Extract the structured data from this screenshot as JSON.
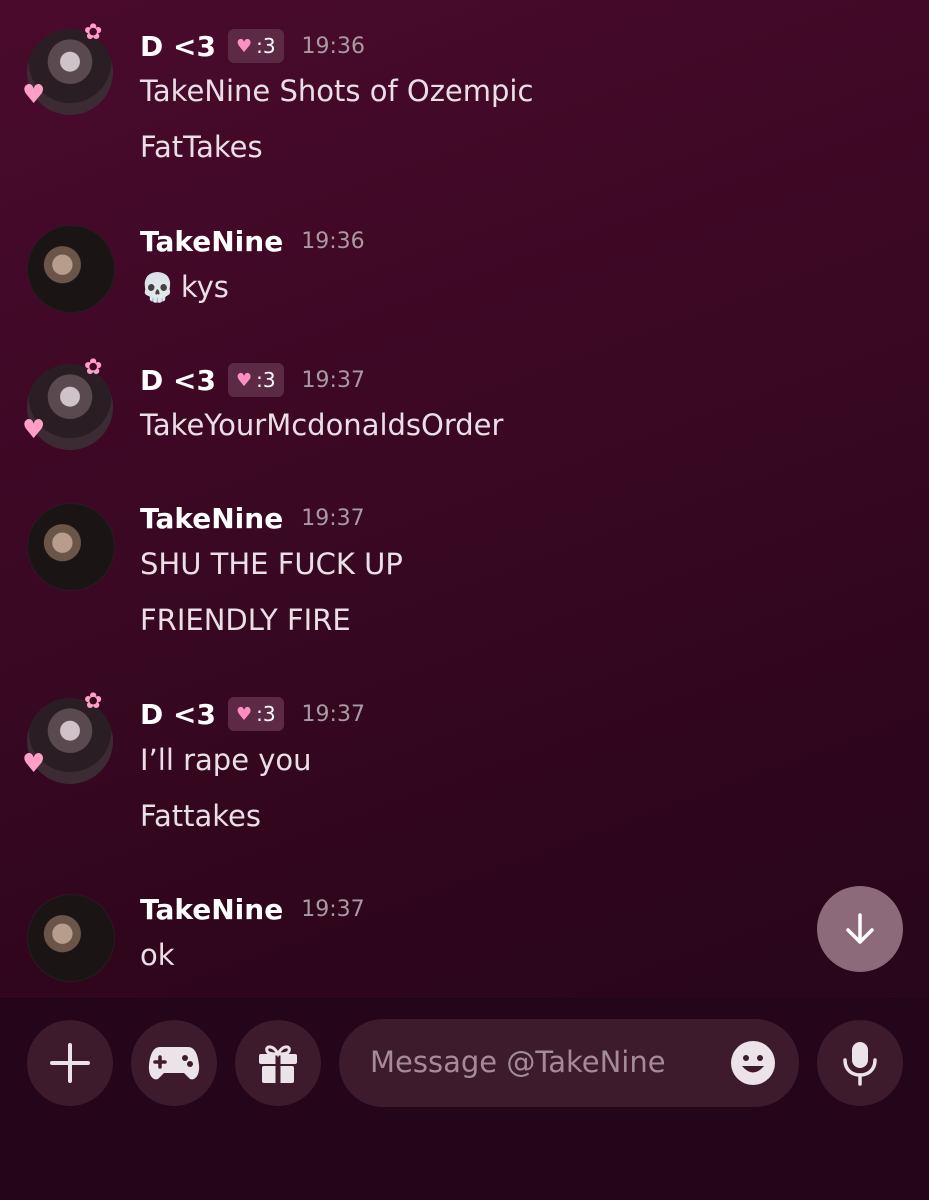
{
  "messages": [
    {
      "author": "D <3",
      "badge": ":3",
      "time": "19:36",
      "lines": [
        "TakeNine Shots of Ozempic",
        "FatTakes"
      ]
    },
    {
      "author": "TakeNine",
      "time": "19:36",
      "lines": [
        "kys"
      ],
      "emoji": "💀"
    },
    {
      "author": "D <3",
      "badge": ":3",
      "time": "19:37",
      "lines": [
        "TakeYourMcdonaldsOrder"
      ]
    },
    {
      "author": "TakeNine",
      "time": "19:37",
      "lines": [
        "SHU THE FUCK UP",
        "FRIENDLY FIRE"
      ]
    },
    {
      "author": "D <3",
      "badge": ":3",
      "time": "19:37",
      "lines": [
        "I’ll rape you",
        "Fattakes"
      ]
    },
    {
      "author": "TakeNine",
      "time": "19:37",
      "lines": [
        "ok"
      ]
    }
  ],
  "composer": {
    "placeholder": "Message @TakeNine",
    "buttons": [
      "plus-icon",
      "gamepad-icon",
      "gift-icon",
      "microphone-icon"
    ]
  },
  "colors": {
    "background": "#3a0823",
    "button": "#3e1a2d",
    "badge": "#5c2a44",
    "scroll_button": "#8c6a7a"
  }
}
